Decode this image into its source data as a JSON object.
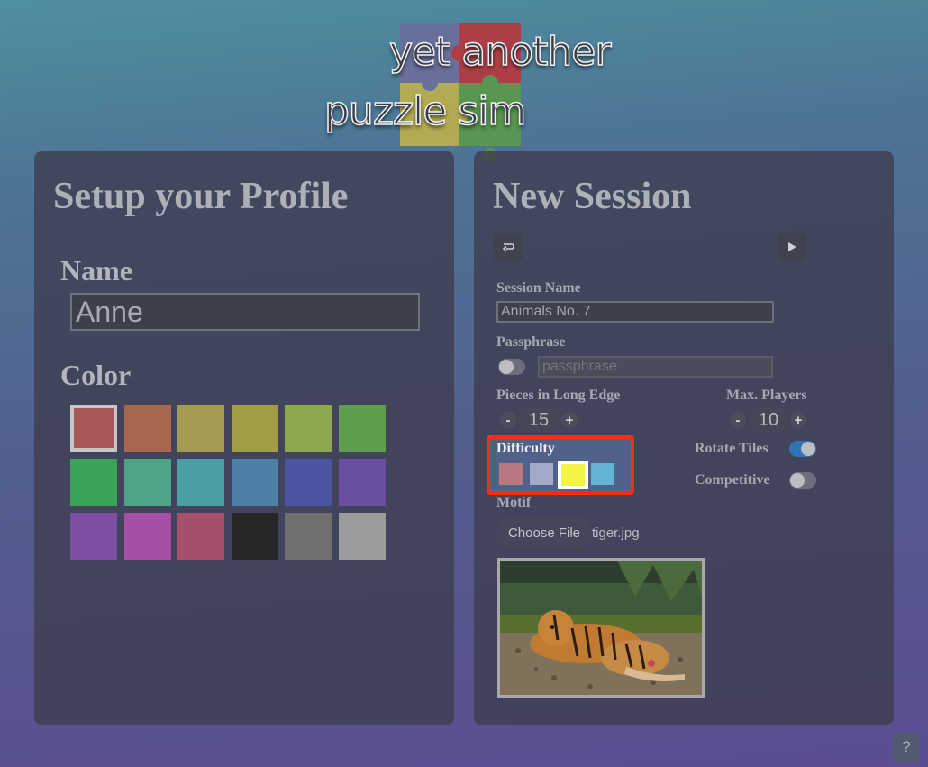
{
  "logo": {
    "line1": "yet another",
    "line2": "puzzle sim"
  },
  "profile": {
    "title": "Setup your Profile",
    "name_label": "Name",
    "name_value": "Anne",
    "color_label": "Color",
    "colors": [
      "#a95859",
      "#a9684e",
      "#a59a52",
      "#a09d44",
      "#8ea84f",
      "#5f9e4e",
      "#3aa357",
      "#4ea487",
      "#4a9fa3",
      "#4d80a4",
      "#4c55a2",
      "#6a4fa2",
      "#7e4ea3",
      "#a64fa3",
      "#a54f6c",
      "#262626",
      "#707070",
      "#9b9b9b"
    ],
    "selected_color_index": 0
  },
  "session": {
    "title": "New Session",
    "back_icon": "return-arrow-icon",
    "play_icon": "play-icon",
    "session_name_label": "Session Name",
    "session_name_value": "Animals No. 7",
    "passphrase_label": "Passphrase",
    "passphrase_placeholder": "passphrase",
    "passphrase_enabled": false,
    "pieces_label": "Pieces in Long Edge",
    "pieces_value": "15",
    "max_players_label": "Max. Players",
    "max_players_value": "10",
    "minus": "-",
    "plus": "+",
    "difficulty_label": "Difficulty",
    "difficulty_colors": [
      "#b77880",
      "#a3a9c9",
      "#f3f346",
      "#63b4d2"
    ],
    "difficulty_selected_index": 2,
    "rotate_label": "Rotate Tiles",
    "rotate_enabled": true,
    "competitive_label": "Competitive",
    "competitive_enabled": false,
    "motif_label": "Motif",
    "choose_file_label": "Choose File",
    "file_name": "tiger.jpg"
  },
  "help_label": "?",
  "accent_colors": {
    "highlight": "#ff2a1a",
    "toggle_on": "#2f75b5"
  }
}
